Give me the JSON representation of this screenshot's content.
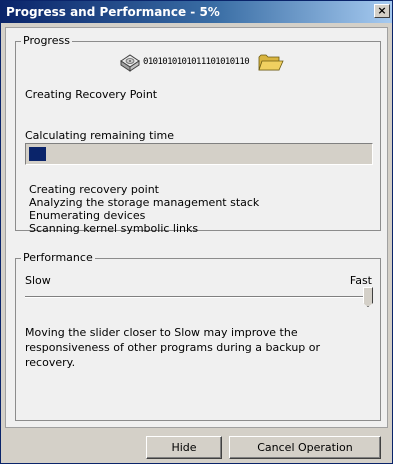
{
  "window": {
    "title": "Progress and Performance - 5%",
    "close_glyph": "×"
  },
  "progress": {
    "group_label": "Progress",
    "bits": "0101010101011101010110",
    "status": "Creating Recovery Point",
    "time_label": "Calculating remaining time",
    "percent": 5,
    "log": [
      "Creating recovery point",
      "Analyzing the storage management stack",
      "Enumerating devices",
      "Scanning kernel symbolic links"
    ]
  },
  "performance": {
    "group_label": "Performance",
    "slow_label": "Slow",
    "fast_label": "Fast",
    "slider_level": 1.0,
    "note": "Moving the slider closer to Slow may improve the responsiveness of other programs during a backup or recovery."
  },
  "buttons": {
    "hide": "Hide",
    "cancel": "Cancel Operation"
  },
  "colors": {
    "accent": "#0a246a",
    "folder": "#f0d060"
  },
  "icons": [
    "hard-drive-icon",
    "folder-icon",
    "close-icon"
  ]
}
